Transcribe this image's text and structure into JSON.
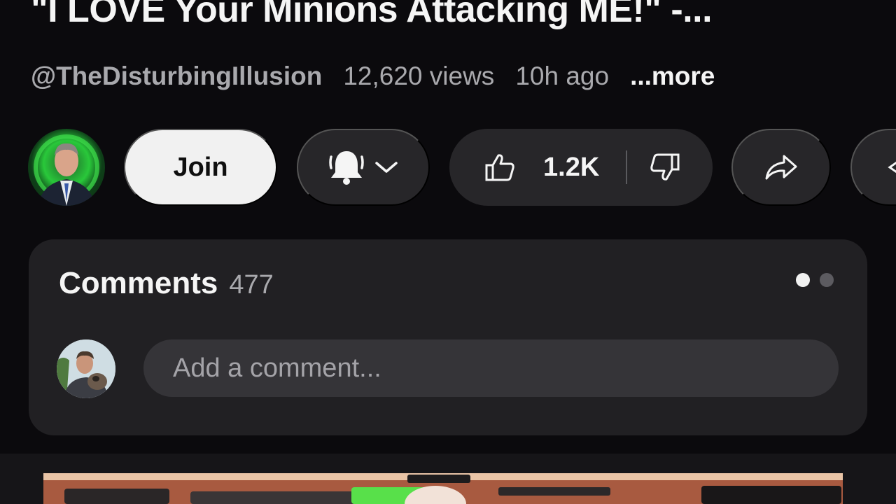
{
  "video": {
    "title": "\"I LOVE Your Minions Attacking ME!\" -...",
    "channel": "@TheDisturbingIllusion",
    "views": "12,620 views",
    "age": "10h ago",
    "more": "...more"
  },
  "actions": {
    "join_label": "Join",
    "like_count": "1.2K",
    "icons": [
      "bell-icon",
      "chevron-down-icon",
      "thumbs-up-icon",
      "thumbs-down-icon",
      "share-icon"
    ]
  },
  "comments": {
    "label": "Comments",
    "count": "477",
    "input_placeholder": "Add a comment...",
    "carousel_pages": 2,
    "active_page": 1
  },
  "colors": {
    "background": "#0b0a0d",
    "pill": "#272629",
    "join_button": "#f1f1f1",
    "card": "#212023",
    "input": "#353438",
    "secondary_text": "#a9a9ad"
  }
}
